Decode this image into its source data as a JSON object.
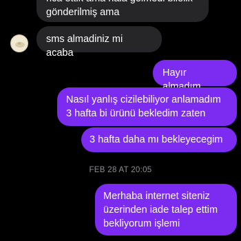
{
  "colors": {
    "background": "#000000",
    "incoming_bubble": "#262628",
    "outgoing_bubble": "#7c2cf0",
    "text": "#ffffff",
    "timestamp": "#8e8e93"
  },
  "messages": [
    {
      "direction": "incoming",
      "text": "rica ettik ama hala gelmedi bilelik\ngönderilmiş ama"
    },
    {
      "direction": "incoming",
      "text": "sms almadiniz mi acaba"
    },
    {
      "direction": "outgoing",
      "text": "Hayır almadım"
    },
    {
      "direction": "outgoing",
      "text": "Nasıl yanlış cizilebiliyor anlamadım\n3 hafta bi ürünü bekledim zaten"
    },
    {
      "direction": "outgoing",
      "text": "3 hafta daha mı bekleyecegim"
    },
    {
      "direction": "outgoing",
      "text": "Merhaba internet siteniz\nüzerinden iade talep ettim\nbekliyorum işlemi"
    }
  ],
  "timestamp": "FEB 28 AT 20:05",
  "avatar": {
    "icon": "user-avatar-icon"
  }
}
